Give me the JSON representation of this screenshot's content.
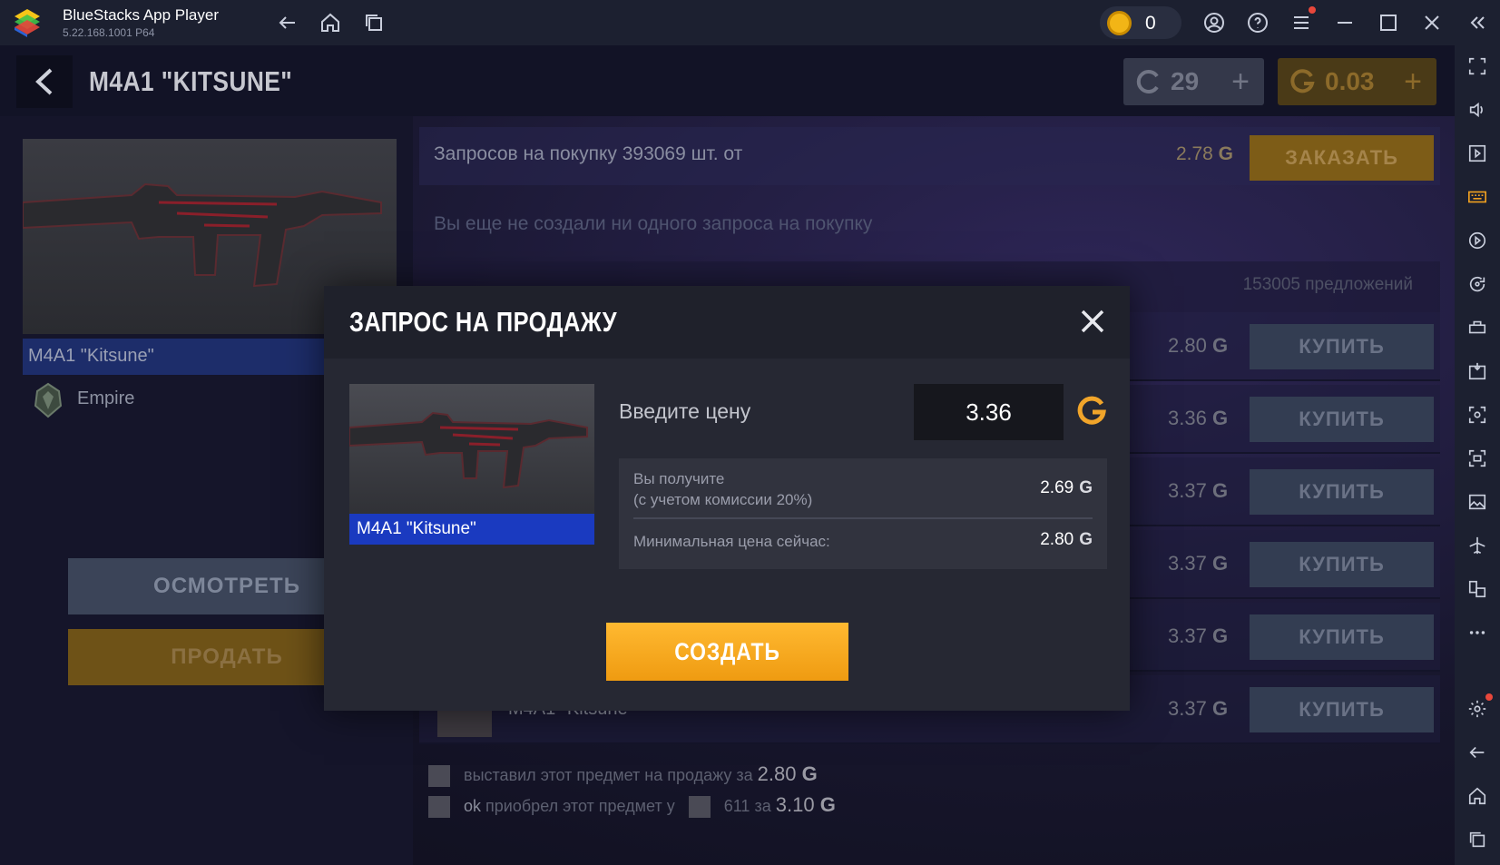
{
  "window": {
    "app_name": "BlueStacks App Player",
    "version": "5.22.168.1001  P64",
    "coins": "0"
  },
  "header": {
    "item_title": "M4A1 \"KITSUNE\"",
    "silver_balance": "29",
    "gold_balance": "0.03"
  },
  "left_panel": {
    "item_name": "M4A1 \"Kitsune\"",
    "collection": "Empire",
    "inspect_label": "ОСМОТРЕТЬ",
    "sell_label": "ПРОДАТЬ"
  },
  "market": {
    "order_text": "Запросов на покупку 393069 шт. от",
    "order_price": "2.78",
    "order_button": "ЗАКАЗАТЬ",
    "no_orders_text": "Вы еще не создали ни одного запроса на покупку",
    "offers_count": "153005 предложений",
    "offers": [
      {
        "price": "2.80",
        "button": "КУПИТЬ"
      },
      {
        "price": "3.36",
        "button": "КУПИТЬ"
      },
      {
        "price": "3.37",
        "button": "КУПИТЬ"
      },
      {
        "price": "3.37",
        "button": "КУПИТЬ"
      },
      {
        "price": "3.37",
        "button": "КУПИТЬ"
      },
      {
        "price": "3.37",
        "button": "КУПИТЬ",
        "seller": "M4A1 \"Kitsune\""
      }
    ],
    "feed": [
      {
        "user": "",
        "text": "выставил этот предмет на продажу за",
        "amount": "2.80"
      },
      {
        "user": "ok",
        "text": "приобрел этот предмет у",
        "other": "611",
        "text2": "за",
        "amount": "3.10"
      }
    ]
  },
  "modal": {
    "title": "ЗАПРОС НА ПРОДАЖУ",
    "item_name": "M4A1 \"Kitsune\"",
    "price_label": "Введите цену",
    "price_value": "3.36",
    "receive_label_1": "Вы получите",
    "receive_label_2": "(с учетом комиссии 20%)",
    "receive_value": "2.69",
    "min_price_label": "Минимальная цена сейчас:",
    "min_price_value": "2.80",
    "create_label": "СОЗДАТЬ"
  },
  "currency_symbol": "G",
  "colors": {
    "accent_orange": "#ffb931",
    "name_bar_blue": "#1a3ac0",
    "gold_icon": "#f2b516"
  }
}
